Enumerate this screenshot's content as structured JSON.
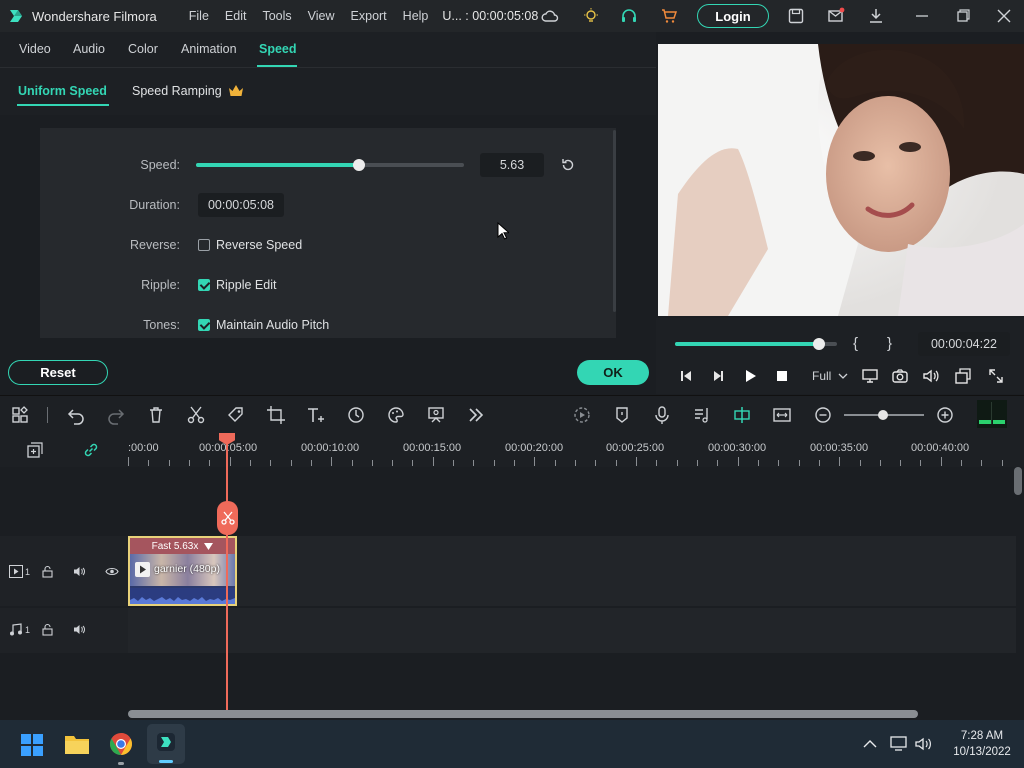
{
  "titlebar": {
    "app_name": "Wondershare Filmora",
    "menu": [
      "File",
      "Edit",
      "Tools",
      "View",
      "Export",
      "Help"
    ],
    "project_info": "U... : 00:00:05:08",
    "login_label": "Login"
  },
  "tabs": [
    {
      "label": "Video"
    },
    {
      "label": "Audio"
    },
    {
      "label": "Color"
    },
    {
      "label": "Animation"
    },
    {
      "label": "Speed",
      "active": true
    }
  ],
  "subtabs": [
    {
      "label": "Uniform Speed",
      "active": true
    },
    {
      "label": "Speed Ramping"
    }
  ],
  "speed_panel": {
    "speed_label": "Speed:",
    "speed_value": "5.63",
    "speed_slider_fraction": 0.61,
    "duration_label": "Duration:",
    "duration_value": "00:00:05:08",
    "reverse_label": "Reverse:",
    "reverse_text": "Reverse Speed",
    "reverse_checked": false,
    "ripple_label": "Ripple:",
    "ripple_text": "Ripple Edit",
    "ripple_checked": true,
    "tones_label": "Tones:",
    "tones_text": "Maintain Audio Pitch",
    "tones_checked": true
  },
  "buttons": {
    "reset_label": "Reset",
    "ok_label": "OK"
  },
  "player": {
    "progress_fraction": 0.89,
    "mark_in": "{",
    "mark_out": "}",
    "timecode": "00:00:04:22",
    "quality": "Full"
  },
  "ruler": {
    "labels": [
      ":00:00",
      "00:00:05:00",
      "00:00:10:00",
      "00:00:15:00",
      "00:00:20:00",
      "00:00:25:00",
      "00:00:30:00",
      "00:00:35:00",
      "00:00:40:00"
    ]
  },
  "tracks": {
    "video_track_num": "1",
    "audio_track_num": "1",
    "clip_speed_label": "Fast 5.63x",
    "clip_name": "garnier (480p)"
  },
  "taskbar": {
    "time": "7:28 AM",
    "date": "10/13/2022"
  },
  "colors": {
    "accent": "#33d6b4",
    "playhead": "#ef6a5a",
    "clip_border": "#e8d27a"
  }
}
